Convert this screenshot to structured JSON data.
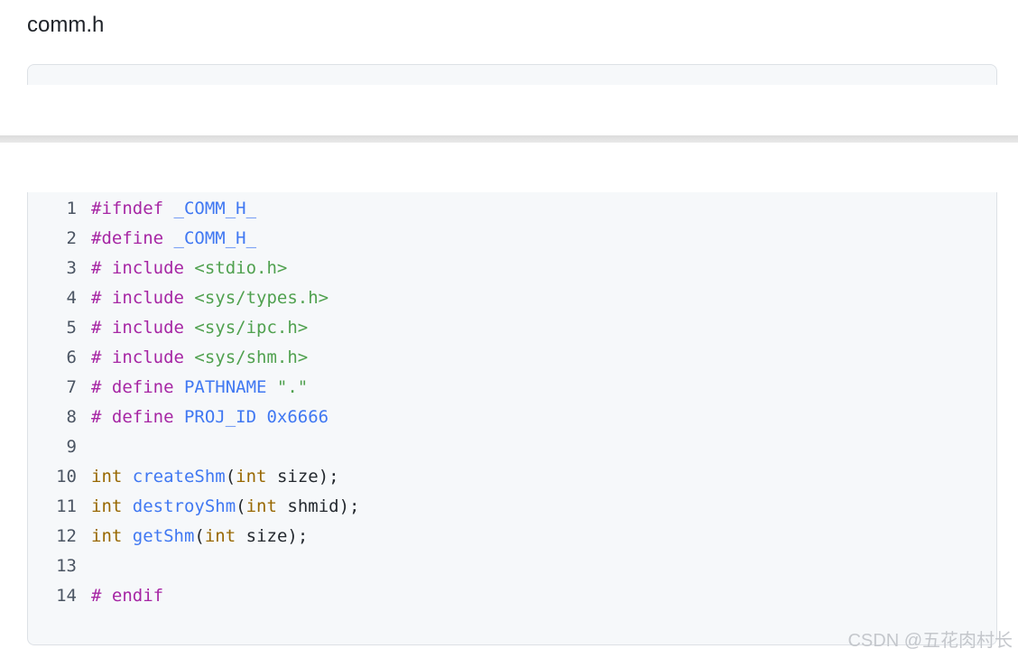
{
  "heading": "comm.h",
  "watermark": "CSDN @五花肉村长",
  "code": {
    "language": "c",
    "lines": [
      {
        "num": "1",
        "tokens": [
          {
            "t": "#ifndef ",
            "c": "kw"
          },
          {
            "t": "_COMM_H_",
            "c": "mc"
          }
        ]
      },
      {
        "num": "2",
        "tokens": [
          {
            "t": "#define ",
            "c": "kw"
          },
          {
            "t": "_COMM_H_",
            "c": "mc"
          }
        ]
      },
      {
        "num": "3",
        "tokens": [
          {
            "t": "# include ",
            "c": "kw"
          },
          {
            "t": "<stdio.h>",
            "c": "str"
          }
        ]
      },
      {
        "num": "4",
        "tokens": [
          {
            "t": "# include ",
            "c": "kw"
          },
          {
            "t": "<sys/types.h>",
            "c": "str"
          }
        ]
      },
      {
        "num": "5",
        "tokens": [
          {
            "t": "# include ",
            "c": "kw"
          },
          {
            "t": "<sys/ipc.h>",
            "c": "str"
          }
        ]
      },
      {
        "num": "6",
        "tokens": [
          {
            "t": "# include ",
            "c": "kw"
          },
          {
            "t": "<sys/shm.h>",
            "c": "str"
          }
        ]
      },
      {
        "num": "7",
        "tokens": [
          {
            "t": "# define ",
            "c": "kw"
          },
          {
            "t": "PATHNAME ",
            "c": "mc"
          },
          {
            "t": "\".\"",
            "c": "str"
          }
        ]
      },
      {
        "num": "8",
        "tokens": [
          {
            "t": "# define ",
            "c": "kw"
          },
          {
            "t": "PROJ_ID 0x6666",
            "c": "mc"
          }
        ]
      },
      {
        "num": "9",
        "tokens": []
      },
      {
        "num": "10",
        "tokens": [
          {
            "t": "int ",
            "c": "ty"
          },
          {
            "t": "createShm",
            "c": "fn"
          },
          {
            "t": "(",
            "c": "plain"
          },
          {
            "t": "int",
            "c": "ty"
          },
          {
            "t": " size);",
            "c": "plain"
          }
        ]
      },
      {
        "num": "11",
        "tokens": [
          {
            "t": "int ",
            "c": "ty"
          },
          {
            "t": "destroyShm",
            "c": "fn"
          },
          {
            "t": "(",
            "c": "plain"
          },
          {
            "t": "int",
            "c": "ty"
          },
          {
            "t": " shmid);",
            "c": "plain"
          }
        ]
      },
      {
        "num": "12",
        "tokens": [
          {
            "t": "int ",
            "c": "ty"
          },
          {
            "t": "getShm",
            "c": "fn"
          },
          {
            "t": "(",
            "c": "plain"
          },
          {
            "t": "int",
            "c": "ty"
          },
          {
            "t": " size);",
            "c": "plain"
          }
        ]
      },
      {
        "num": "13",
        "tokens": []
      },
      {
        "num": "14",
        "tokens": [
          {
            "t": "# endif",
            "c": "kw"
          }
        ]
      }
    ]
  },
  "colors": {
    "keyword": "#a626a4",
    "macro": "#4078f2",
    "string": "#50a14f",
    "type": "#986801",
    "function": "#4078f2",
    "code_background": "#f6f8fa"
  }
}
